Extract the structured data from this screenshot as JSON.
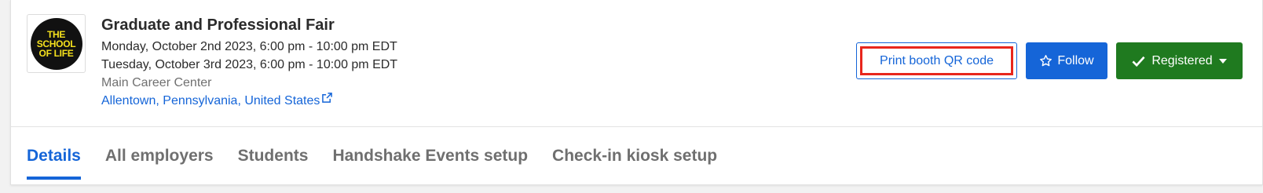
{
  "event": {
    "title": "Graduate and Professional Fair",
    "dates": [
      "Monday, October 2nd 2023, 6:00 pm - 10:00 pm EDT",
      "Tuesday, October 3rd 2023, 6:00 pm - 10:00 pm EDT"
    ],
    "venue": "Main Career Center",
    "location": "Allentown, Pennsylvania, United States",
    "logo": {
      "lines": [
        "THE",
        "SCHOOL",
        "OF LIFE"
      ],
      "bg_color": "#111111",
      "text_color": "#f5e11d"
    }
  },
  "actions": {
    "print_label": "Print booth QR code",
    "follow_label": "Follow",
    "follow_icon": "star-outline-icon",
    "registered_label": "Registered",
    "registered_icon": "checkmark-icon",
    "dropdown_icon": "caret-down-icon"
  },
  "tabs": [
    {
      "label": "Details",
      "active": true
    },
    {
      "label": "All employers",
      "active": false
    },
    {
      "label": "Students",
      "active": false
    },
    {
      "label": "Handshake Events setup",
      "active": false
    },
    {
      "label": "Check-in kiosk setup",
      "active": false
    }
  ],
  "colors": {
    "accent": "#1565d8",
    "success": "#1f7a1f",
    "highlight": "#e8261c"
  }
}
